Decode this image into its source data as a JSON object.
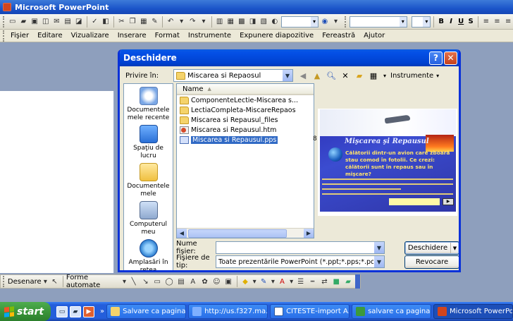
{
  "app": {
    "title": "Microsoft PowerPoint"
  },
  "menu": {
    "items": [
      "Fişier",
      "Editare",
      "Vizualizare",
      "Inserare",
      "Format",
      "Instrumente",
      "Expunere diapozitive",
      "Fereastră",
      "Ajutor"
    ]
  },
  "format_toolbar": {
    "bold": "B",
    "italic": "I",
    "underline": "U",
    "shadow": "S"
  },
  "dialog": {
    "title": "Deschidere",
    "help_button": "?",
    "close_button": "✕",
    "look_in_label": "Privire în:",
    "look_in_value": "Miscarea si Repaosul",
    "tools_label": "Instrumente",
    "places": [
      {
        "label": "Documentele mele recente",
        "icon": "recent-documents-icon"
      },
      {
        "label": "Spaţiu de lucru",
        "icon": "desktop-icon"
      },
      {
        "label": "Documentele mele",
        "icon": "my-documents-icon"
      },
      {
        "label": "Computerul meu",
        "icon": "my-computer-icon"
      },
      {
        "label": "Amplasări în reţea",
        "icon": "network-places-icon"
      }
    ],
    "file_list": {
      "column_name": "Name",
      "files": [
        {
          "name": "ComponenteLectie-Miscarea s...",
          "type": "folder"
        },
        {
          "name": "LectiaCompleta-MiscareRepaos",
          "type": "folder"
        },
        {
          "name": "Miscarea si Repausul_files",
          "type": "folder"
        },
        {
          "name": "Miscarea si Repausul.htm",
          "type": "htm"
        },
        {
          "name": "Miscarea si Repausul.pps",
          "type": "pps",
          "selected": true
        }
      ],
      "stray_value": "8"
    },
    "preview": {
      "title": "Mişcarea şi Repausul",
      "text": "Călătorii dintr-un avion care zboară stau comod în fotolii. Ce crezi: călătorii sunt în repaus sau în mişcare?",
      "nav_button": "▶"
    },
    "file_name_label": "Nume fişier:",
    "file_name_value": "",
    "file_type_label": "Fişiere de tip:",
    "file_type_value": "Toate prezentările PowerPoint (*.ppt;*.pps;*.pot;*.htm;*.html)",
    "open_button": "Deschidere",
    "cancel_button": "Revocare"
  },
  "drawing_toolbar": {
    "draw_label": "Desenare",
    "autoshapes_label": "Forme automate"
  },
  "taskbar": {
    "start_label": "start",
    "overflow": "»",
    "tasks": [
      {
        "label": "Salvare ca pagina ...",
        "icon": "folder-icon"
      },
      {
        "label": "http://us.f327.ma...",
        "icon": "browser-icon"
      },
      {
        "label": "CITESTE-import A...",
        "icon": "word-icon"
      },
      {
        "label": "salvare ca pagina ...",
        "icon": "app-icon"
      },
      {
        "label": "Microsoft PowerPoint",
        "icon": "powerpoint-icon",
        "active": true
      }
    ]
  },
  "colors": {
    "xp_blue": "#0831d9",
    "selection": "#316ac5",
    "workspace": "#8e9fbd"
  }
}
